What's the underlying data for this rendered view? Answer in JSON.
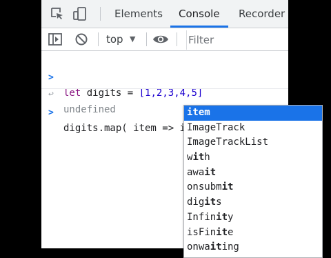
{
  "devtools": {
    "tabs": [
      {
        "label": "Elements",
        "active": false
      },
      {
        "label": "Console",
        "active": true
      },
      {
        "label": "Recorder",
        "active": false
      }
    ],
    "toolbar": {
      "context_label": "top",
      "filter_placeholder": "Filter"
    },
    "console": {
      "lines": [
        {
          "kind": "input",
          "code": {
            "keyword": "let",
            "name": "digits",
            "op": "=",
            "array": "[1,2,3,4,5]"
          }
        },
        {
          "kind": "result",
          "text": "undefined"
        },
        {
          "kind": "current-input",
          "typed_before": "digits.map( item => it",
          "typed_after": "em"
        }
      ]
    },
    "autocomplete": {
      "typed_prefix": "it",
      "items": [
        {
          "pre": "",
          "match": "it",
          "post": "em",
          "selected": true
        },
        {
          "pre": "ImageTrack",
          "match": "",
          "post": "",
          "selected": false
        },
        {
          "pre": "ImageTrackList",
          "match": "",
          "post": "",
          "selected": false
        },
        {
          "pre": "w",
          "match": "it",
          "post": "h",
          "selected": false
        },
        {
          "pre": "awa",
          "match": "it",
          "post": "",
          "selected": false
        },
        {
          "pre": "onsubm",
          "match": "it",
          "post": "",
          "selected": false
        },
        {
          "pre": "dig",
          "match": "it",
          "post": "s",
          "selected": false
        },
        {
          "pre": "Infin",
          "match": "it",
          "post": "y",
          "selected": false
        },
        {
          "pre": "isFin",
          "match": "it",
          "post": "e",
          "selected": false
        },
        {
          "pre": "onwa",
          "match": "it",
          "post": "ing",
          "selected": false
        }
      ]
    },
    "colors": {
      "accent": "#1a73e8",
      "keyword": "#881280",
      "number": "#1c00cf",
      "muted": "#80868b"
    },
    "icons": [
      "inspect-element-icon",
      "device-toolbar-icon",
      "sidebar-toggle-icon",
      "clear-console-icon",
      "eye-icon",
      "prompt-chevron-icon",
      "return-arrow-icon"
    ]
  }
}
